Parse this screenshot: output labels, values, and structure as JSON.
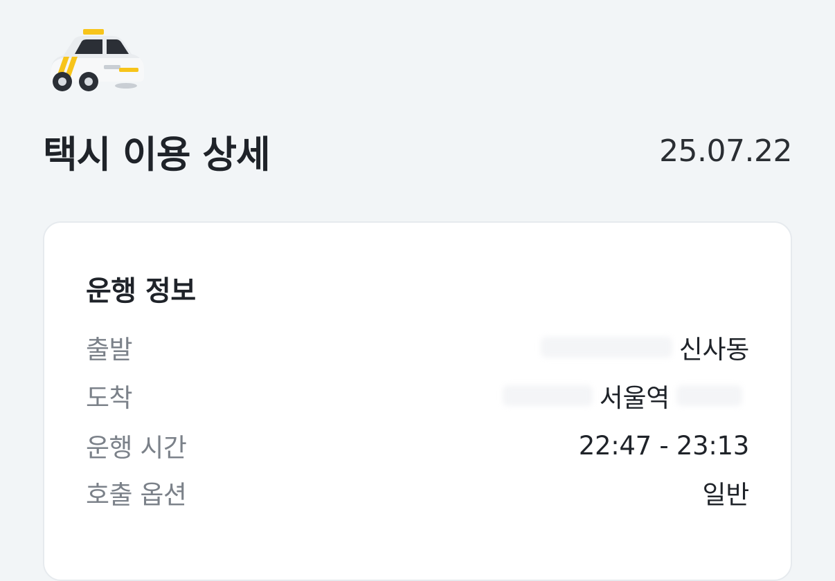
{
  "header": {
    "icon": "taxi-icon",
    "title": "택시 이용 상세",
    "date": "25.07.22"
  },
  "trip_info": {
    "title": "운행 정보",
    "rows": [
      {
        "label": "출발",
        "value": "신사동"
      },
      {
        "label": "도착",
        "value": "서울역"
      },
      {
        "label": "운행 시간",
        "value": "22:47 - 23:13"
      },
      {
        "label": "호출 옵션",
        "value": "일반"
      }
    ]
  },
  "colors": {
    "background": "#f2f5f7",
    "card": "#ffffff",
    "label": "#7b8189",
    "text": "#1f2329",
    "taxi_accent": "#f7c41b"
  }
}
